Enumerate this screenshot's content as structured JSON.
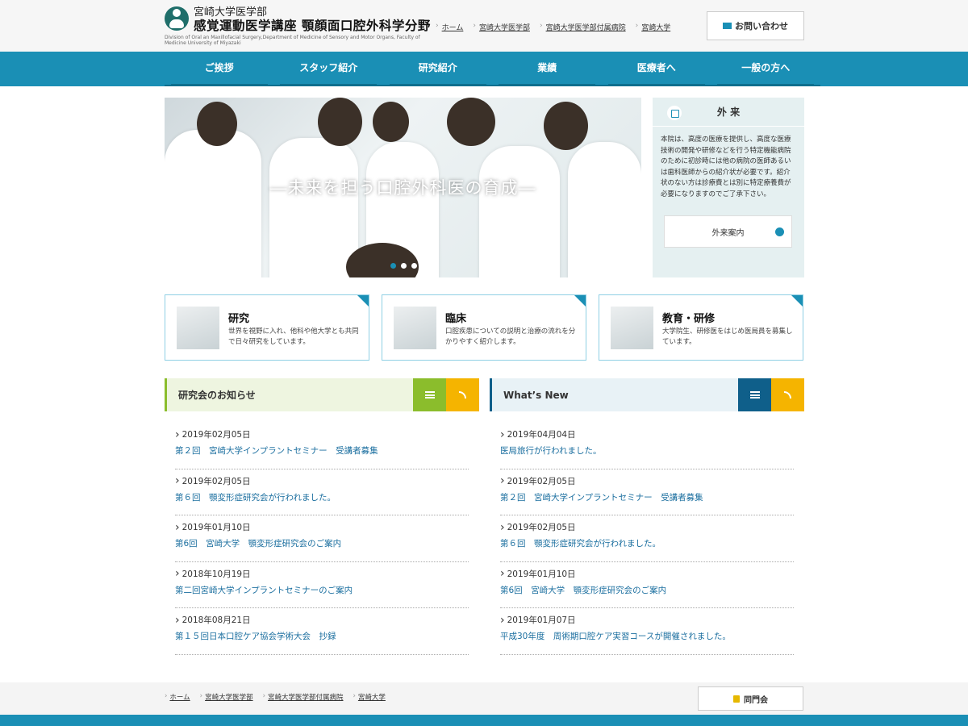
{
  "header": {
    "logo_sub": "宮崎大学医学部",
    "logo_title": "感覚運動医学講座 顎顔面口腔外科学分野",
    "logo_en": "Division of Oral an Maxillofacial Surgery,Department of Medicine of Sensory and Motor Organs, Faculty of Medicine University of Miyazaki",
    "top_links": [
      "ホーム",
      "宮崎大学医学部",
      "宮崎大学医学部付属病院",
      "宮崎大学"
    ],
    "contact_label": "お問い合わせ"
  },
  "nav": [
    "ご挨拶",
    "スタッフ紹介",
    "研究紹介",
    "業績",
    "医療者へ",
    "一般の方へ"
  ],
  "hero": {
    "caption": "―未来を担う口腔外科医の育成―",
    "dots": 3,
    "active_dot": 0
  },
  "outpatient": {
    "title": "外 来",
    "text": "本院は、高度の医療を提供し、高度な医療技術の開発や研修などを行う特定機能病院のために初診時には他の病院の医師あるいは歯科医師からの紹介状が必要です。紹介状のない方は診療費とは別に特定療養費が必要になりますのでご了承下さい。",
    "button": "外来案内"
  },
  "cards": [
    {
      "title": "研究",
      "desc": "世界を視野に入れ、他科や他大学とも共同で日々研究をしています。"
    },
    {
      "title": "臨床",
      "desc": "口腔疾患についての説明と治療の流れを分かりやすく紹介します。"
    },
    {
      "title": "教育・研修",
      "desc": "大学院生、研修医をはじめ医局員を募集しています。"
    }
  ],
  "study_news": {
    "title": "研究会のお知らせ",
    "items": [
      {
        "date": "2019年02月05日",
        "title": "第２回　宮崎大学インプラントセミナー　受講者募集"
      },
      {
        "date": "2019年02月05日",
        "title": "第６回　顎変形症研究会が行われました。"
      },
      {
        "date": "2019年01月10日",
        "title": "第6回　宮崎大学　顎変形症研究会のご案内"
      },
      {
        "date": "2018年10月19日",
        "title": "第二回宮崎大学インプラントセミナーのご案内"
      },
      {
        "date": "2018年08月21日",
        "title": "第１５回日本口腔ケア協会学術大会　抄録"
      }
    ]
  },
  "whats_new": {
    "title": "What’s New",
    "items": [
      {
        "date": "2019年04月04日",
        "title": "医局旅行が行われました。"
      },
      {
        "date": "2019年02月05日",
        "title": "第２回　宮崎大学インプラントセミナー　受講者募集"
      },
      {
        "date": "2019年02月05日",
        "title": "第６回　顎変形症研究会が行われました。"
      },
      {
        "date": "2019年01月10日",
        "title": "第6回　宮崎大学　顎変形症研究会のご案内"
      },
      {
        "date": "2019年01月07日",
        "title": "平成30年度　周術期口腔ケア実習コースが開催されました。"
      }
    ]
  },
  "footer": {
    "links": [
      "ホーム",
      "宮崎大学医学部",
      "宮崎大学医学部付属病院",
      "宮崎大学"
    ],
    "alumni_label": "同門会"
  },
  "colors": {
    "accent": "#1a8fb5",
    "study_list_btn": "#8bbd2c",
    "study_bg": "#eef5e0",
    "news_list_btn": "#0f5f8a",
    "news_bg": "#e8f2f6",
    "rss": "#f5b400"
  }
}
